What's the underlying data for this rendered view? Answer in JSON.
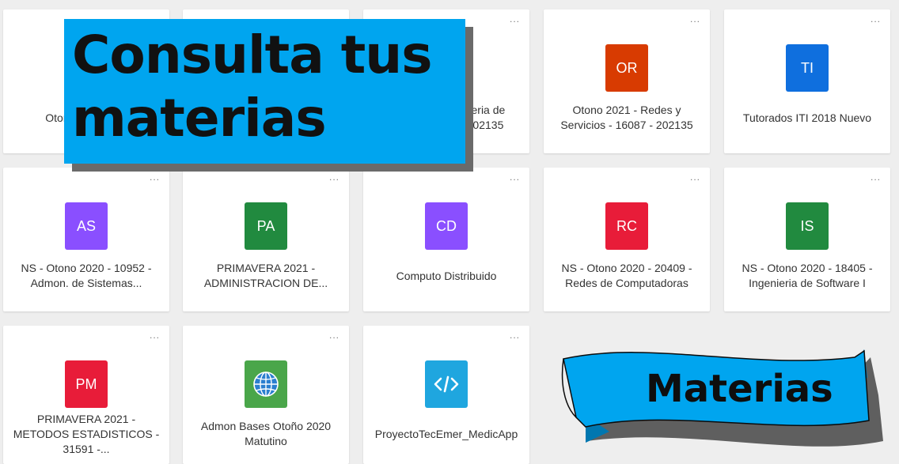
{
  "more_label": "...",
  "cards": [
    {
      "initials": "",
      "color": "#ffffff",
      "name": "Otono 2 Desarro"
    },
    {
      "initials": "",
      "color": "#ffffff",
      "name": ""
    },
    {
      "initials": "",
      "color": "#333333",
      "name": "neria de 202135"
    },
    {
      "initials": "OR",
      "color": "#d83b01",
      "name": "Otono 2021 - Redes y Servicios - 16087 - 202135"
    },
    {
      "initials": "TI",
      "color": "#0f6fde",
      "name": "Tutorados ITI 2018 Nuevo"
    },
    {
      "initials": "AS",
      "color": "#8a4fff",
      "name": "NS - Otono 2020 - 10952 - Admon. de Sistemas..."
    },
    {
      "initials": "PA",
      "color": "#218a3f",
      "name": "PRIMAVERA 2021 - ADMINISTRACION DE..."
    },
    {
      "initials": "CD",
      "color": "#8a4fff",
      "name": "Computo Distribuido"
    },
    {
      "initials": "RC",
      "color": "#e81c39",
      "name": "NS - Otono 2020 - 20409 - Redes de Computadoras"
    },
    {
      "initials": "IS",
      "color": "#218a3f",
      "name": "NS - Otono 2020 - 18405 - Ingenieria de Software I"
    },
    {
      "initials": "PM",
      "color": "#e81c39",
      "name": "PRIMAVERA 2021 - METODOS ESTADISTICOS - 31591 -..."
    },
    {
      "icon": "globe-icon",
      "color": "#4aa64a",
      "name": "Admon Bases Otoño 2020 Matutino"
    },
    {
      "icon": "code-icon",
      "color": "#1fa6df",
      "name": "ProyectoTecEmer_MedicApp"
    }
  ],
  "banner": {
    "line1": "Consulta tus",
    "line2": "materias",
    "color": "#00a5ef"
  },
  "ribbon": {
    "label": "Materias",
    "color": "#00a5ef"
  }
}
